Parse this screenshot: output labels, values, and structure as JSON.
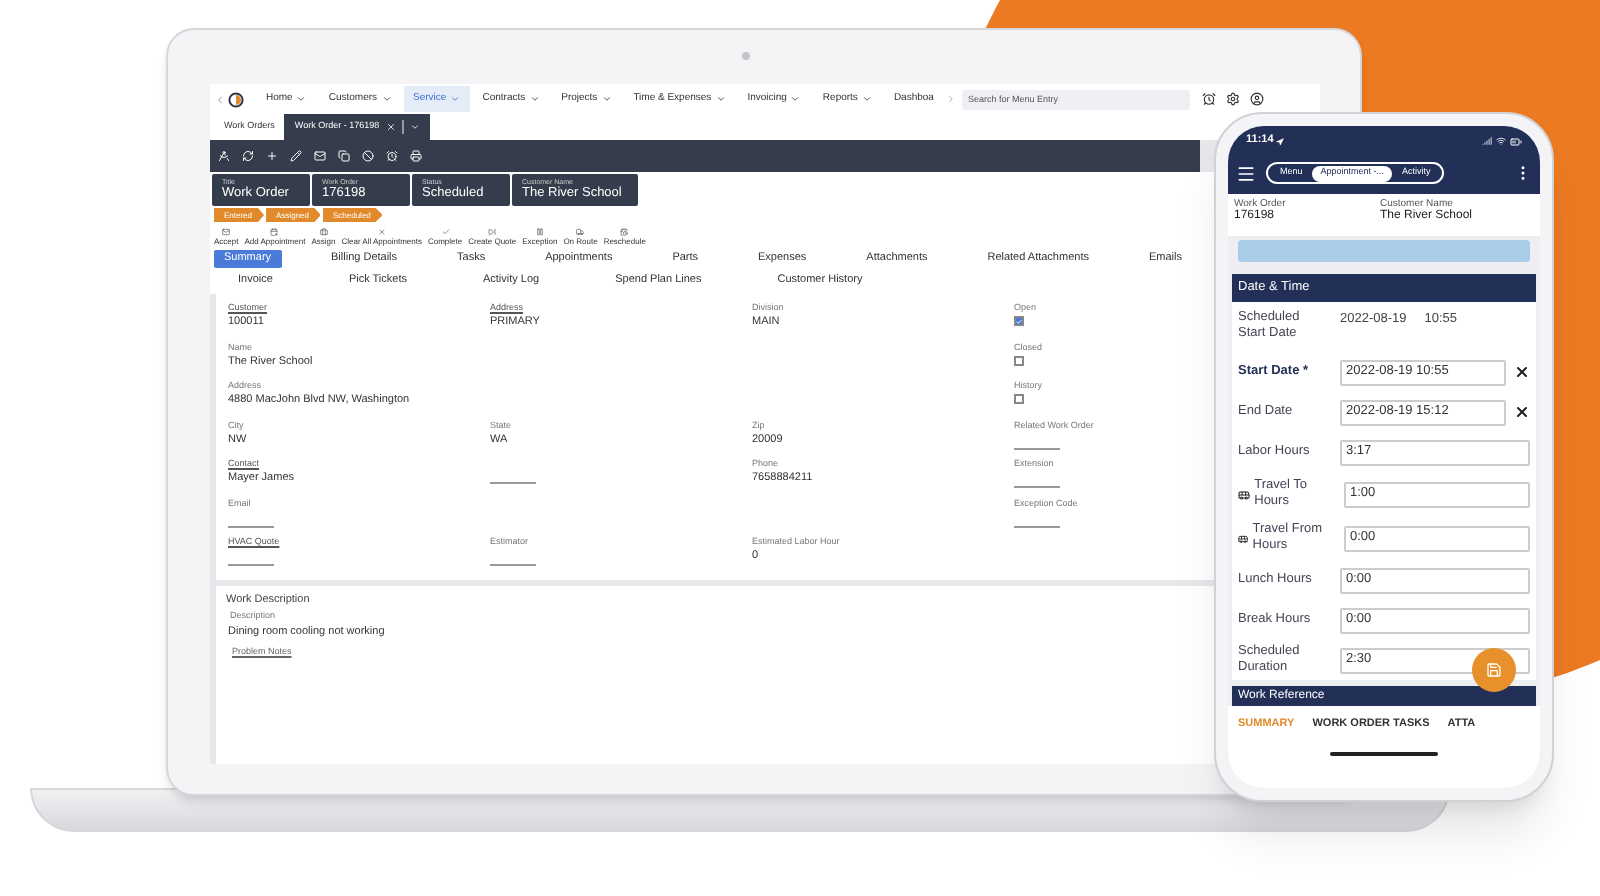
{
  "laptop": {
    "nav": {
      "items": [
        {
          "label": "Home",
          "selected": false
        },
        {
          "label": "Customers",
          "selected": false
        },
        {
          "label": "Service",
          "selected": true
        },
        {
          "label": "Contracts",
          "selected": false
        },
        {
          "label": "Projects",
          "selected": false
        },
        {
          "label": "Time & Expenses",
          "selected": false
        },
        {
          "label": "Invoicing",
          "selected": false
        },
        {
          "label": "Reports",
          "selected": false
        },
        {
          "label": "Dashboa",
          "selected": false
        }
      ],
      "search": {
        "placeholder": "Search for Menu Entry"
      }
    },
    "tabs": [
      {
        "label": "Work Orders",
        "selected": false
      },
      {
        "label": "Work Order - 176198",
        "selected": true
      }
    ],
    "header_fields": [
      {
        "label": "Title",
        "value": "Work Order"
      },
      {
        "label": "Work Order",
        "value": "176198"
      },
      {
        "label": "Status",
        "value": "Scheduled"
      },
      {
        "label": "Customer Name",
        "value": "The River School"
      }
    ],
    "status_steps": [
      "Entered",
      "Assigned",
      "Scheduled"
    ],
    "actions": [
      "Accept",
      "Add Appointment",
      "Assign",
      "Clear All Appointments",
      "Complete",
      "Create Quote",
      "Exception",
      "On Route",
      "Reschedule"
    ],
    "section_tab_rows": [
      [
        {
          "label": "Summary",
          "selected": true
        },
        {
          "label": "Billing Details",
          "selected": false
        },
        {
          "label": "Tasks",
          "selected": false
        },
        {
          "label": "Appointments",
          "selected": false
        },
        {
          "label": "Parts",
          "selected": false
        },
        {
          "label": "Expenses",
          "selected": false
        },
        {
          "label": "Attachments",
          "selected": false
        },
        {
          "label": "Related Attachments",
          "selected": false
        },
        {
          "label": "Emails",
          "selected": false
        }
      ],
      [
        {
          "label": "Invoice",
          "selected": false
        },
        {
          "label": "Pick Tickets",
          "selected": false
        },
        {
          "label": "Activity Log",
          "selected": false
        },
        {
          "label": "Spend Plan Lines",
          "selected": false
        },
        {
          "label": "Customer History",
          "selected": false
        }
      ]
    ],
    "field_rows": [
      [
        {
          "label": "Customer",
          "value": "100011",
          "link": true
        },
        {
          "label": "Address",
          "value": "PRIMARY",
          "link": true
        },
        {
          "label": "Division",
          "value": "MAIN",
          "link": false
        },
        {
          "label": "Open",
          "checked": true,
          "link": false
        }
      ],
      [
        {
          "label": "Name",
          "value": "The River School",
          "link": false
        },
        null,
        null,
        {
          "label": "Closed",
          "checked": false,
          "link": false
        }
      ],
      [
        {
          "label": "Address",
          "value": "4880 MacJohn Blvd NW, Washington",
          "link": false
        },
        null,
        null,
        {
          "label": "History",
          "checked": false,
          "link": false
        }
      ],
      [
        {
          "label": "City",
          "value": "NW",
          "link": false
        },
        {
          "label": "State",
          "value": "WA",
          "link": false
        },
        {
          "label": "Zip",
          "value": "20009",
          "link": false
        },
        {
          "label": "Related Work Order",
          "link": false
        }
      ],
      [
        {
          "label": "Contact",
          "value": "Mayer James",
          "link": true
        },
        {},
        {
          "label": "Phone",
          "value": "7658884211",
          "link": false
        },
        {
          "label": "Extension",
          "link": false
        }
      ],
      [
        {
          "label": "Email",
          "link": false
        },
        null,
        null,
        {
          "label": "Exception Code",
          "link": false
        }
      ],
      [
        {
          "label": "HVAC Quote",
          "link": true
        },
        {
          "label": "Estimator",
          "link": false
        },
        {
          "label": "Estimated Labor Hour",
          "value": "0",
          "link": false
        },
        null
      ]
    ],
    "work_description": {
      "title": "Work Description",
      "label": "Description",
      "value": "Dining room cooling not working",
      "link": "Problem Notes"
    }
  },
  "phone": {
    "time": "11:14",
    "segments": [
      {
        "label": "Menu",
        "selected": false
      },
      {
        "label": "Appointment -...",
        "selected": true
      },
      {
        "label": "Activity",
        "selected": false
      }
    ],
    "info": [
      {
        "label": "Work Order",
        "value": "176198"
      },
      {
        "label": "Customer Name",
        "value": "The River School"
      }
    ],
    "section": "Date & Time",
    "rows": [
      {
        "kind": "text",
        "label": "Scheduled Start Date",
        "value": "2022-08-19",
        "value_2": "10:55",
        "required": false
      },
      {
        "kind": "clear_input",
        "label": "Start Date *",
        "value": "2022-08-19 10:55",
        "required": true
      },
      {
        "kind": "clear_input",
        "label": "End Date",
        "value": "2022-08-19 15:12",
        "required": false
      },
      {
        "kind": "input",
        "label": "Labor Hours",
        "value": "3:17",
        "required": false
      },
      {
        "kind": "bus_input",
        "label": "Travel To Hours",
        "value": "1:00",
        "required": false
      },
      {
        "kind": "bus_input",
        "label": "Travel From Hours",
        "value": "0:00",
        "required": false
      },
      {
        "kind": "input",
        "label": "Lunch Hours",
        "value": "0:00",
        "required": false
      },
      {
        "kind": "input",
        "label": "Break Hours",
        "value": "0:00",
        "required": false
      },
      {
        "kind": "input",
        "label": "Scheduled Duration",
        "value": "2:30",
        "required": false
      }
    ],
    "next_section": "Work Reference",
    "bottom_tabs": [
      {
        "label": "SUMMARY",
        "selected": true
      },
      {
        "label": "WORK ORDER TASKS",
        "selected": false
      },
      {
        "label": "ATTA",
        "selected": false
      }
    ]
  }
}
